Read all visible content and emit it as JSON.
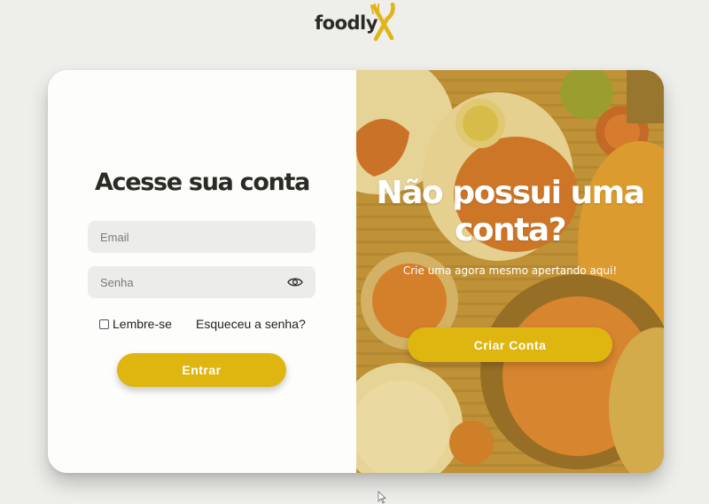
{
  "brand": {
    "logo_text": "foodly"
  },
  "login": {
    "title": "Acesse sua conta",
    "email_placeholder": "Email",
    "password_placeholder": "Senha",
    "remember_label": "Lembre-se",
    "forgot_link": "Esqueceu a senha?",
    "submit_label": "Entrar"
  },
  "signup_panel": {
    "title": "Não possui uma conta?",
    "subtitle": "Crie uma agora mesmo apertando aqui!",
    "button_label": "Criar Conta"
  },
  "icons": {
    "logo": "fork-knife-x-icon",
    "password_toggle": "eye-icon",
    "cursor": "mouse-pointer-icon"
  },
  "colors": {
    "accent": "#deb60f",
    "background": "#eeeeea",
    "text_dark": "#2b2a24",
    "input_bg": "#ececea"
  }
}
